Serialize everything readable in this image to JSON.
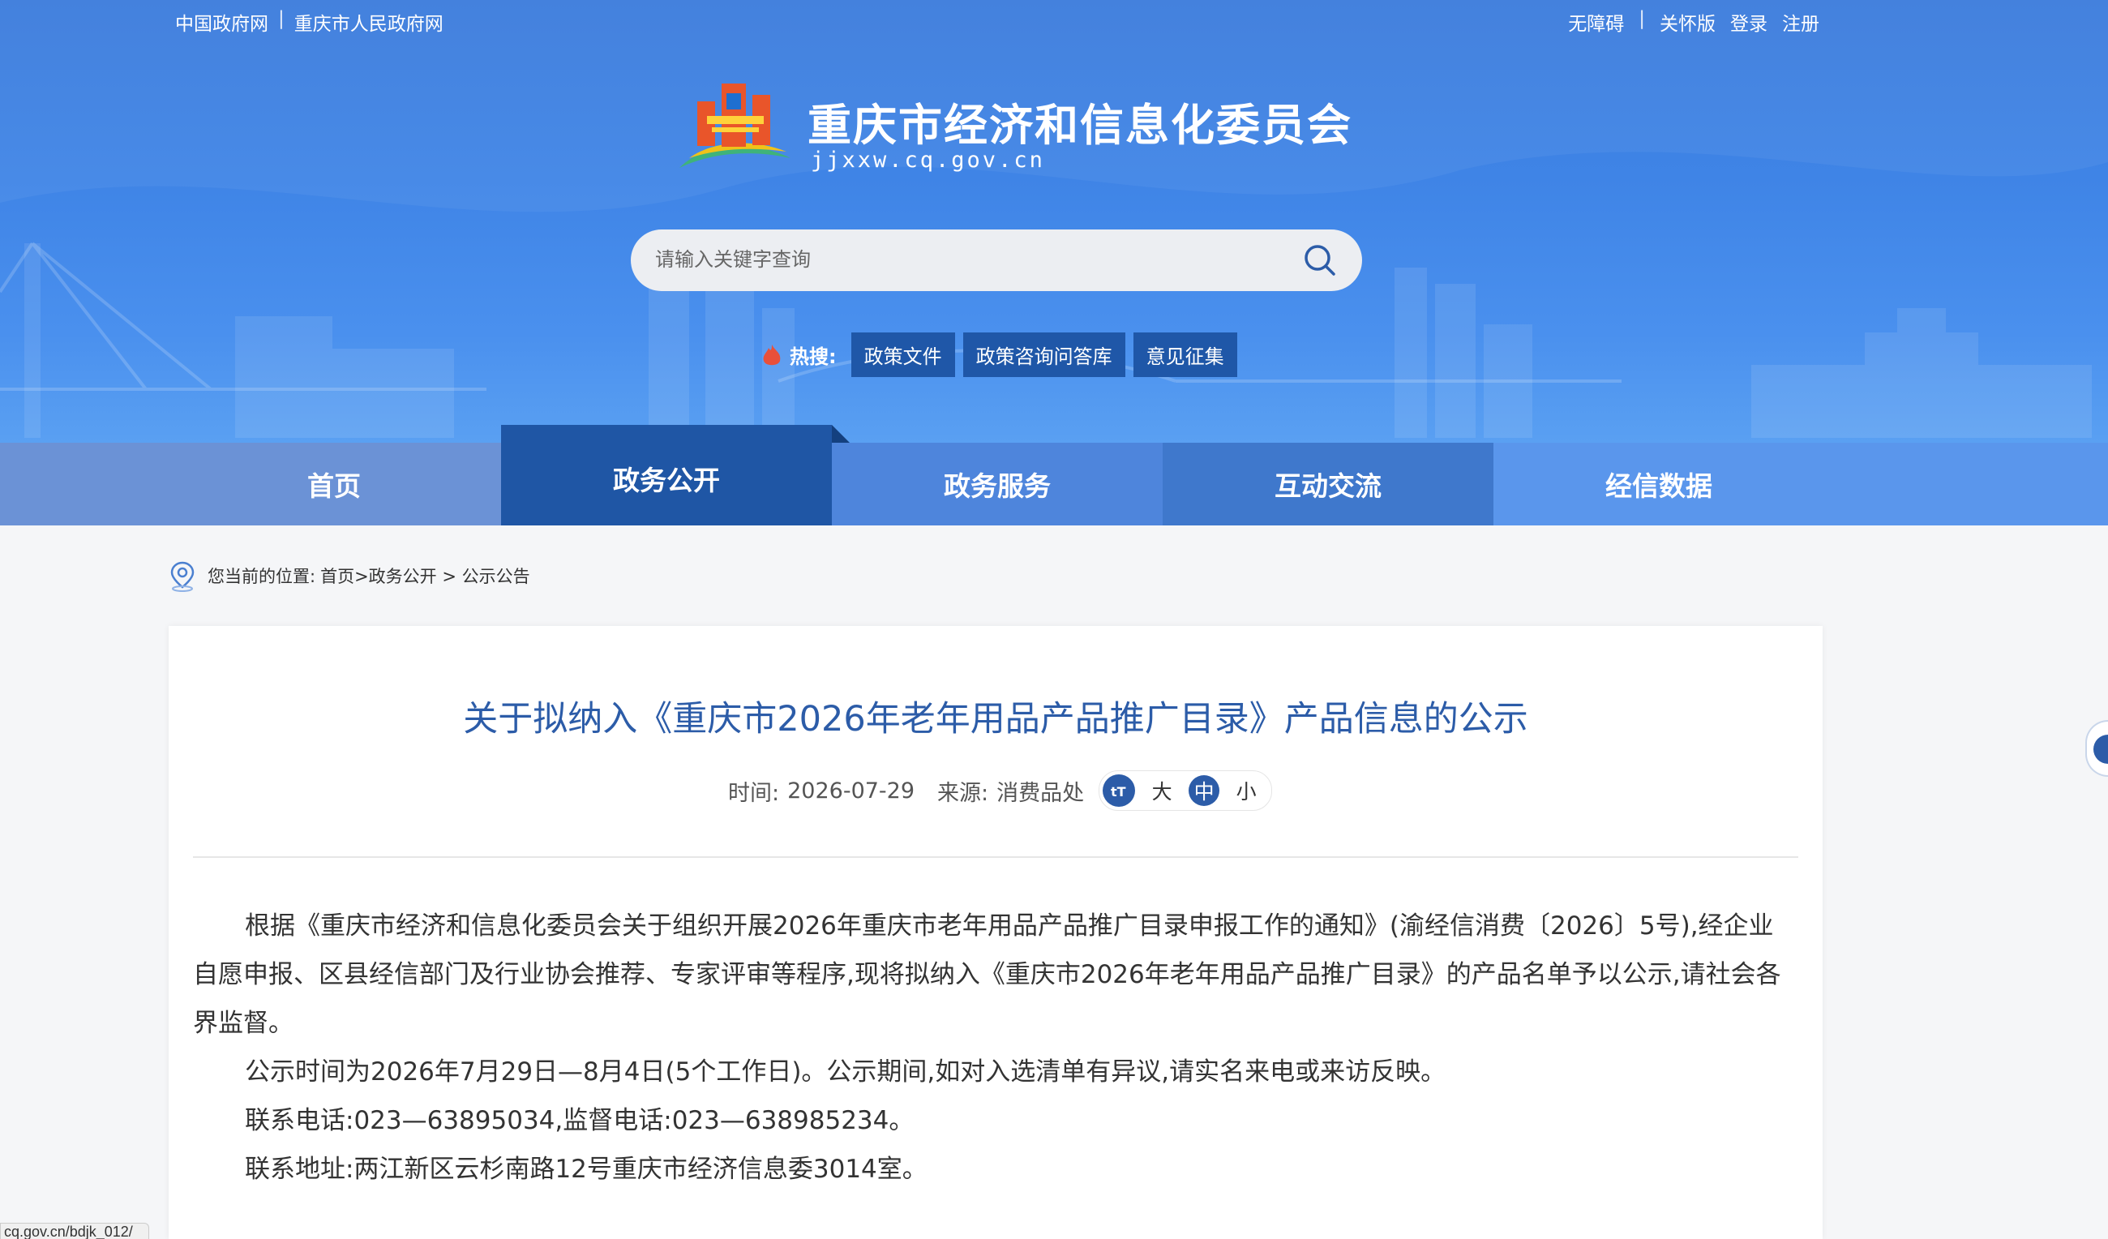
{
  "top_links": {
    "left": [
      "中国政府网",
      "重庆市人民政府网"
    ],
    "right": [
      "无障碍",
      "关怀版",
      "登录",
      "注册"
    ]
  },
  "site": {
    "title": "重庆市经济和信息化委员会",
    "url": "jjxxw.cq.gov.cn"
  },
  "search": {
    "placeholder": "请输入关键字查询"
  },
  "hot_search": {
    "label": "热搜:",
    "tags": [
      "政策文件",
      "政策咨询问答库",
      "意见征集"
    ]
  },
  "nav": {
    "items": [
      "首页",
      "政务公开",
      "政务服务",
      "互动交流",
      "经信数据"
    ],
    "active": "政务公开"
  },
  "breadcrumb": {
    "label": "您当前的位置:",
    "path": "首页>政务公开 > 公示公告"
  },
  "article": {
    "title": "关于拟纳入《重庆市2026年老年用品产品推广目录》产品信息的公示",
    "time_label": "时间:",
    "time": "2026-07-29",
    "source_label": "来源:",
    "source": "消费品处",
    "font_sizes": [
      "大",
      "中",
      "小"
    ],
    "font_selected": "中",
    "paragraphs": [
      "根据《重庆市经济和信息化委员会关于组织开展2026年重庆市老年用品产品推广目录申报工作的通知》(渝经信消费〔2026〕5号),经企业自愿申报、区县经信部门及行业协会推荐、专家评审等程序,现将拟纳入《重庆市2026年老年用品产品推广目录》的产品名单予以公示,请社会各界监督。",
      "公示时间为2026年7月29日—8月4日(5个工作日)。公示期间,如对入选清单有异议,请实名来电或来访反映。",
      "联系电话:023—63895034,监督电话:023—638985234。",
      "联系地址:两江新区云杉南路12号重庆市经济信息委3014室。"
    ]
  },
  "status_bar": {
    "text": "cq.gov.cn/bdjk_012/"
  },
  "colors": {
    "header_blue": "#3f84e6",
    "nav_active": "#1f56a5",
    "title_blue": "#2c5ca8",
    "hot_tag_bg": "#1f57a8"
  }
}
